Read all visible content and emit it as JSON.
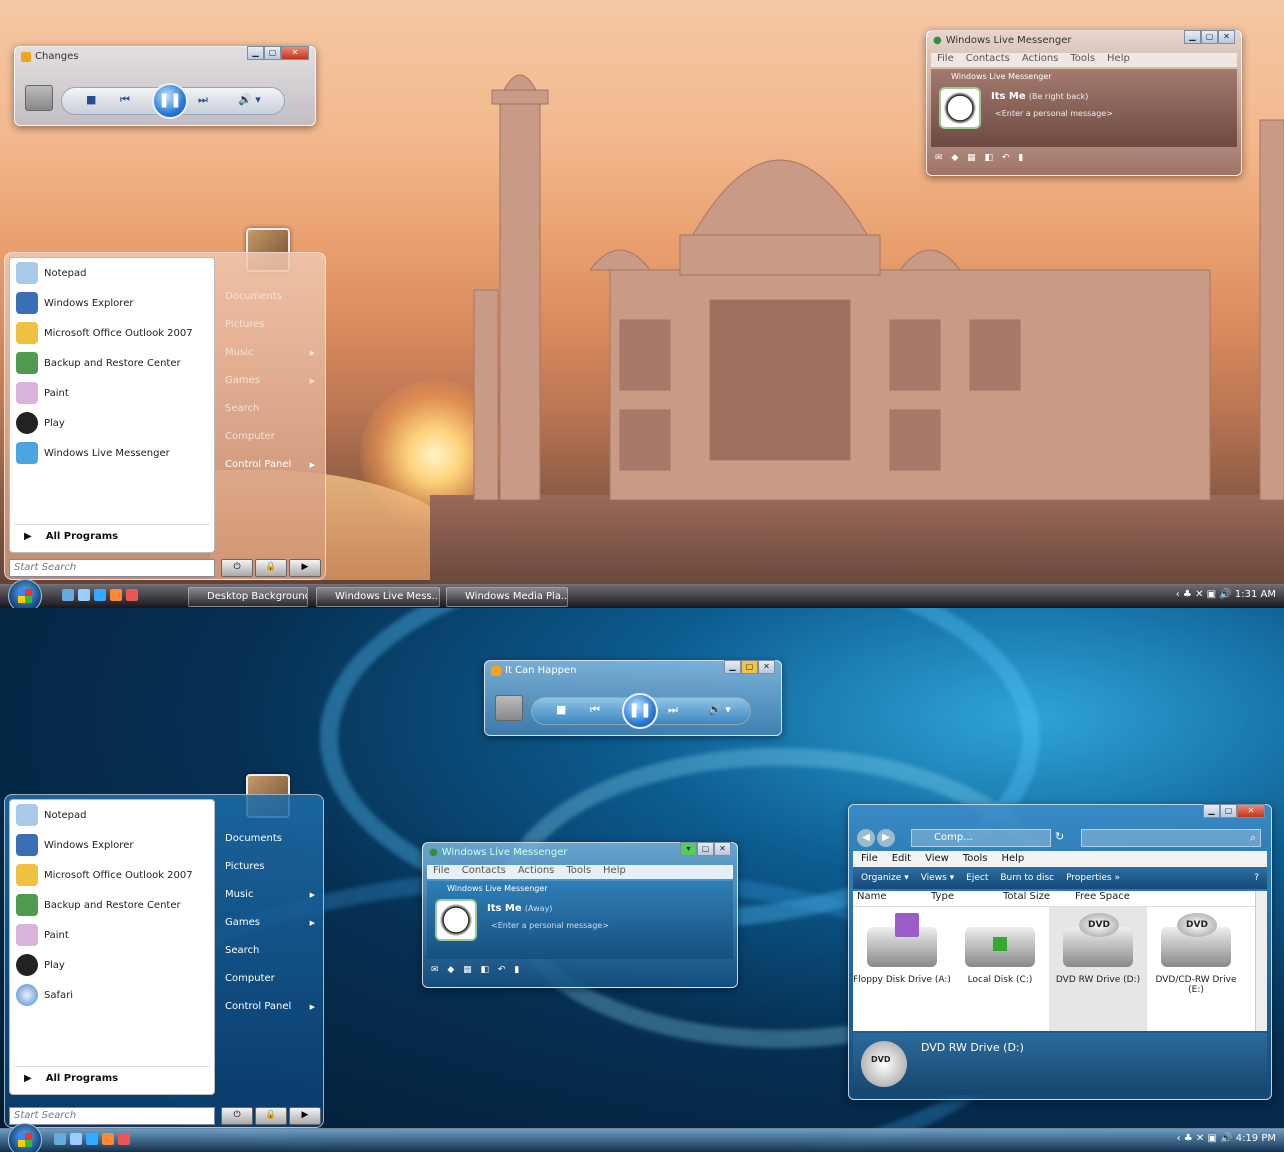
{
  "top_desktop": {
    "media_player": {
      "title": "Changes"
    },
    "messenger": {
      "title": "Windows Live Messenger",
      "menu": [
        "File",
        "Contacts",
        "Actions",
        "Tools",
        "Help"
      ],
      "header": "Windows Live Messenger",
      "name": "Its Me",
      "status": "(Be right back)",
      "personal_message": "<Enter a personal message>"
    },
    "start_menu": {
      "items": [
        "Notepad",
        "Windows Explorer",
        "Microsoft Office Outlook 2007",
        "Backup and Restore Center",
        "Paint",
        "Play",
        "Windows Live Messenger"
      ],
      "all_programs": "All Programs",
      "right": [
        "Documents",
        "Pictures",
        "Music",
        "Games",
        "Search",
        "Computer",
        "Control Panel"
      ],
      "search_placeholder": "Start Search"
    },
    "taskbar": {
      "buttons": [
        "Desktop Background",
        "Windows Live Mess...",
        "Windows Media Pla..."
      ],
      "clock": "1:31 AM"
    }
  },
  "bottom_desktop": {
    "media_player": {
      "title": "It Can Happen"
    },
    "messenger": {
      "title": "Windows Live Messenger",
      "menu": [
        "File",
        "Contacts",
        "Actions",
        "Tools",
        "Help"
      ],
      "header": "Windows Live Messenger",
      "name": "Its Me",
      "status": "(Away)",
      "personal_message": "<Enter a personal message>"
    },
    "start_menu": {
      "items": [
        "Notepad",
        "Windows Explorer",
        "Microsoft Office Outlook 2007",
        "Backup and Restore Center",
        "Paint",
        "Play",
        "Safari"
      ],
      "all_programs": "All Programs",
      "right": [
        "Documents",
        "Pictures",
        "Music",
        "Games",
        "Search",
        "Computer",
        "Control Panel"
      ],
      "search_placeholder": "Start Search"
    },
    "explorer": {
      "address": "Comp...",
      "menu": [
        "File",
        "Edit",
        "View",
        "Tools",
        "Help"
      ],
      "commands": [
        "Organize",
        "Views",
        "Eject",
        "Burn to disc",
        "Properties"
      ],
      "columns": [
        "Name",
        "Type",
        "Total Size",
        "Free Space"
      ],
      "drives": [
        {
          "name": "Floppy Disk Drive (A:)"
        },
        {
          "name": "Local Disk (C:)"
        },
        {
          "name": "DVD RW Drive (D:)",
          "badge": "DVD"
        },
        {
          "name": "DVD/CD-RW Drive (E:)",
          "badge": "DVD"
        }
      ],
      "detail": "DVD RW Drive (D:)",
      "detail_badge": "DVD"
    },
    "taskbar": {
      "clock": "4:19 PM"
    }
  }
}
